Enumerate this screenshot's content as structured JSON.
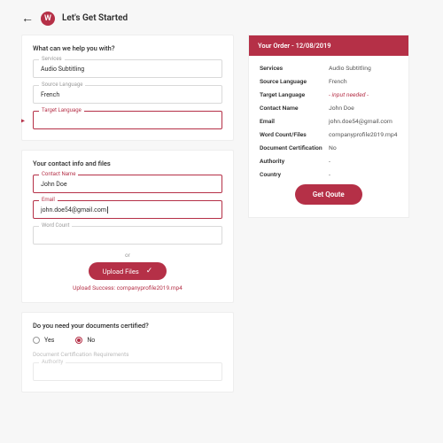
{
  "header": {
    "logo_letter": "W",
    "title": "Let's Get Started"
  },
  "section1": {
    "title": "What can we help you with?",
    "services_label": "Services",
    "services_value": "Audio Subtitling",
    "source_lang_label": "Source Language",
    "source_lang_value": "French",
    "target_lang_label": "Target Language",
    "target_lang_value": ""
  },
  "section2": {
    "title": "Your contact info and files",
    "contact_label": "Contact Name",
    "contact_value": "John Doe",
    "email_label": "Email",
    "email_value": "john.doe54@gmail.com",
    "wordcount_label": "Word Count",
    "wordcount_value": "",
    "or": "or",
    "upload_btn": "Upload Files",
    "upload_status_prefix": "Upload Success: ",
    "upload_filename": "companyprofile2019.mp4"
  },
  "section3": {
    "title": "Do you need your documents certified?",
    "yes": "Yes",
    "no": "No",
    "selected": "No",
    "req_label": "Document Certification Requirements",
    "authority_label": "Authority",
    "authority_value": ""
  },
  "summary": {
    "head_prefix": "Your Order - ",
    "date": "12/08/2019",
    "rows": [
      {
        "k": "Services",
        "v": "Audio Subtitling"
      },
      {
        "k": "Source Language",
        "v": "French"
      },
      {
        "k": "Target Language",
        "v": "- input needed -",
        "need": true
      },
      {
        "k": "Contact Name",
        "v": "John Doe"
      },
      {
        "k": "Email",
        "v": "john.doe54@gmail.com"
      },
      {
        "k": "Word Count/Files",
        "v": "companyprofile2019.mp4"
      },
      {
        "k": "Document Certification",
        "v": "No"
      },
      {
        "k": "Authority",
        "v": "-"
      },
      {
        "k": "Country",
        "v": "-"
      }
    ],
    "quote_btn": "Get Qoute"
  }
}
